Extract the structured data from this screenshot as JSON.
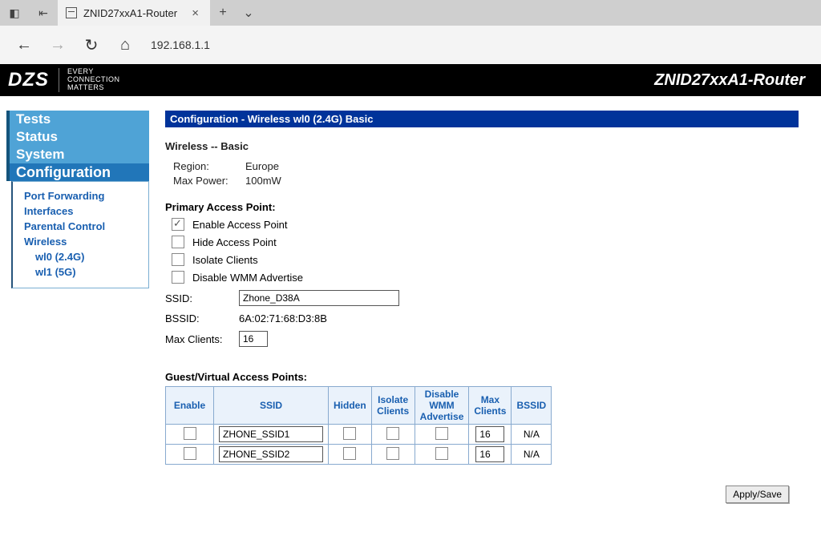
{
  "browser": {
    "tab_title": "ZNID27xxA1-Router",
    "address": "192.168.1.1"
  },
  "header": {
    "logo": "DZS",
    "tagline1": "EVERY",
    "tagline2": "CONNECTION",
    "tagline3": "MATTERS",
    "device": "ZNID27xxA1-Router"
  },
  "sidebar": {
    "tests": "Tests",
    "status": "Status",
    "system": "System",
    "configuration": "Configuration",
    "port_forwarding": "Port Forwarding",
    "interfaces": "Interfaces",
    "parental": "Parental Control",
    "wireless": "Wireless",
    "wl0": "wl0 (2.4G)",
    "wl1": "wl1 (5G)"
  },
  "page": {
    "title": "Configuration - Wireless wl0 (2.4G) Basic",
    "section": "Wireless -- Basic",
    "region_label": "Region:",
    "region_value": "Europe",
    "maxpower_label": "Max Power:",
    "maxpower_value": "100mW",
    "primary_head": "Primary Access Point:",
    "enable_ap": "Enable Access Point",
    "hide_ap": "Hide Access Point",
    "isolate": "Isolate Clients",
    "disable_wmm": "Disable WMM Advertise",
    "ssid_label": "SSID:",
    "ssid_value": "Zhone_D38A",
    "bssid_label": "BSSID:",
    "bssid_value": "6A:02:71:68:D3:8B",
    "maxclients_label": "Max Clients:",
    "maxclients_value": "16",
    "guest_head": "Guest/Virtual Access Points:",
    "guest_cols": {
      "enable": "Enable",
      "ssid": "SSID",
      "hidden": "Hidden",
      "isolate": "Isolate Clients",
      "wmm": "Disable WMM Advertise",
      "max": "Max Clients",
      "bssid": "BSSID"
    },
    "guest_rows": [
      {
        "ssid": "ZHONE_SSID1",
        "max": "16",
        "bssid": "N/A"
      },
      {
        "ssid": "ZHONE_SSID2",
        "max": "16",
        "bssid": "N/A"
      }
    ],
    "apply": "Apply/Save"
  }
}
